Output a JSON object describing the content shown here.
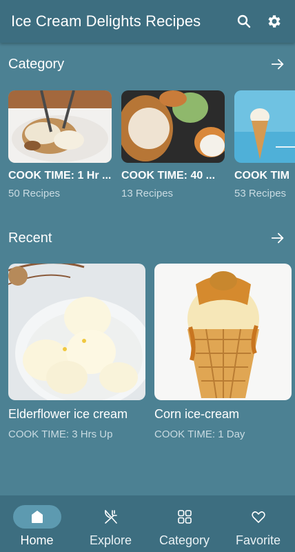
{
  "app_bar": {
    "title": "Ice Cream Delights Recipes",
    "icons": [
      "search-icon",
      "gear-icon"
    ]
  },
  "category": {
    "title": "Category",
    "items": [
      {
        "name": "COOK TIME: 1 Hr ...",
        "count": "50 Recipes"
      },
      {
        "name": "COOK TIME: 40 ...",
        "count": "13 Recipes"
      },
      {
        "name": "COOK TIM",
        "count": "53 Recipes"
      }
    ]
  },
  "recent": {
    "title": "Recent",
    "items": [
      {
        "name": "Elderflower ice cream",
        "time": "COOK TIME: 3 Hrs Up"
      },
      {
        "name": "Corn ice-cream",
        "time": "COOK TIME: 1 Day"
      }
    ]
  },
  "bottom_nav": {
    "active": "Home",
    "items": [
      {
        "label": "Home",
        "icon": "home-icon"
      },
      {
        "label": "Explore",
        "icon": "utensils-icon"
      },
      {
        "label": "Category",
        "icon": "grid-icon"
      },
      {
        "label": "Favorite",
        "icon": "heart-icon"
      }
    ]
  },
  "colors": {
    "background": "#4c8193",
    "bar": "#3d6e80",
    "active_pill": "#5d9ab0",
    "secondary_text": "#c9dbe2"
  }
}
